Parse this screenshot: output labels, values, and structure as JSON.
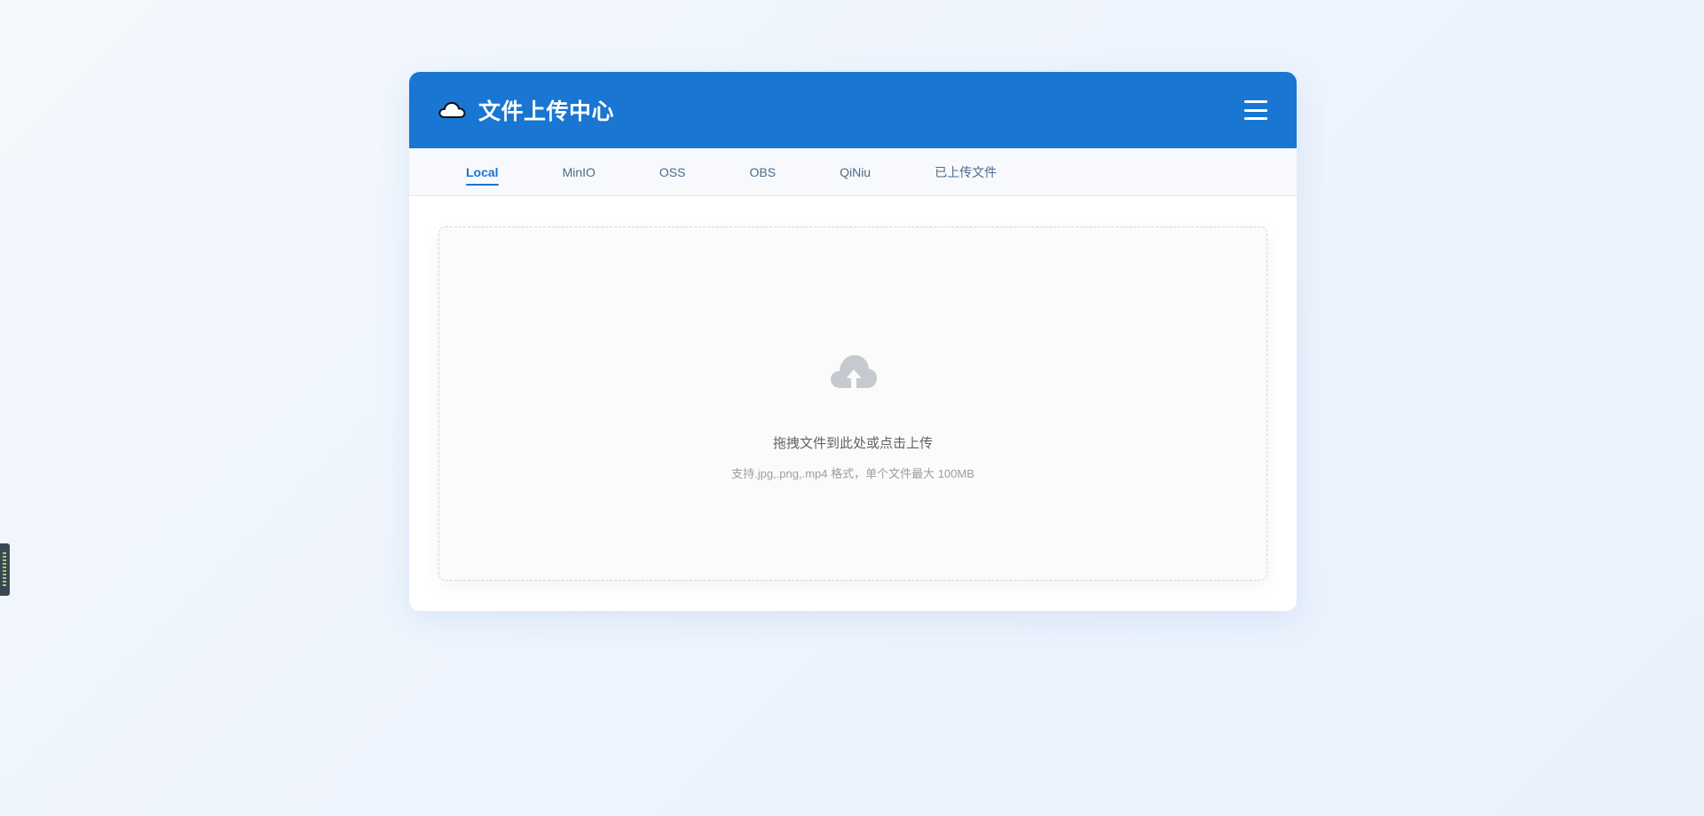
{
  "header": {
    "icon": "cloud-icon",
    "title": "文件上传中心",
    "menu_icon": "hamburger-menu-icon"
  },
  "tabs": [
    {
      "label": "Local",
      "active": true
    },
    {
      "label": "MinIO",
      "active": false
    },
    {
      "label": "OSS",
      "active": false
    },
    {
      "label": "OBS",
      "active": false
    },
    {
      "label": "QiNiu",
      "active": false
    },
    {
      "label": "已上传文件",
      "active": false
    }
  ],
  "dropzone": {
    "icon": "cloud-upload-icon",
    "main_text": "拖拽文件到此处或点击上传",
    "hint_text": "支持.jpg,.png,.mp4 格式，单个文件最大 100MB"
  },
  "colors": {
    "primary": "#1976d2",
    "icon_gray": "#c6c9cf"
  }
}
